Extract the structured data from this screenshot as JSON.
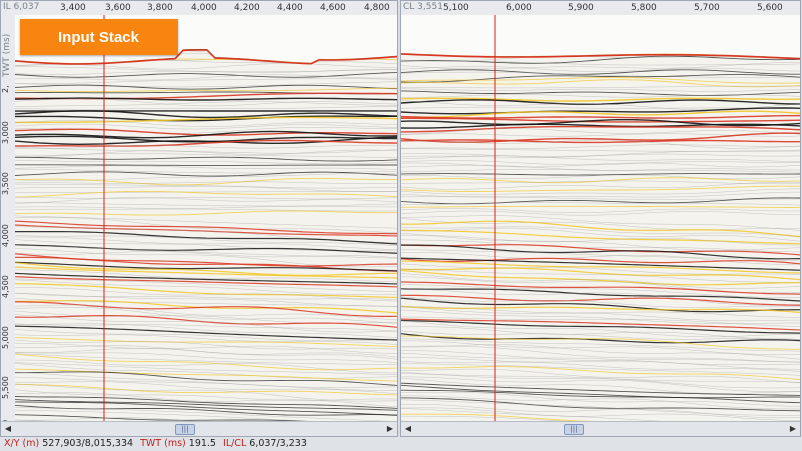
{
  "left_panel": {
    "axis_title": "IL 6,037",
    "x_ticks": [
      "3,400",
      "3,600",
      "3,800",
      "4,000",
      "4,200",
      "4,400",
      "4,600",
      "4,800"
    ],
    "y_label": "TWT (ms)",
    "y_ticks": [
      "3,000",
      "3,500",
      "4,000",
      "4,500",
      "5,000",
      "5,500",
      "000"
    ],
    "y_partial_tick": "2,",
    "badge_label": "Input Stack",
    "thumb_label": "|||"
  },
  "right_panel": {
    "axis_title": "CL 3,551",
    "x_ticks": [
      "5,100",
      "6,000",
      "5,900",
      "5,800",
      "5,700",
      "5,600"
    ],
    "thumb_label": "|||"
  },
  "status_bar": {
    "xy_label": "X/Y (m)",
    "xy_value": "527,903/8,015,334",
    "twt_label": "TWT (ms)",
    "twt_value": "191.5",
    "ilcl_label": "IL/CL",
    "ilcl_value": "6,037/3,233"
  },
  "colors": {
    "cursor_line": "#d7201a",
    "trough": "#141414",
    "peak_yellow": "#f2c522",
    "peak_red": "#d93621"
  }
}
